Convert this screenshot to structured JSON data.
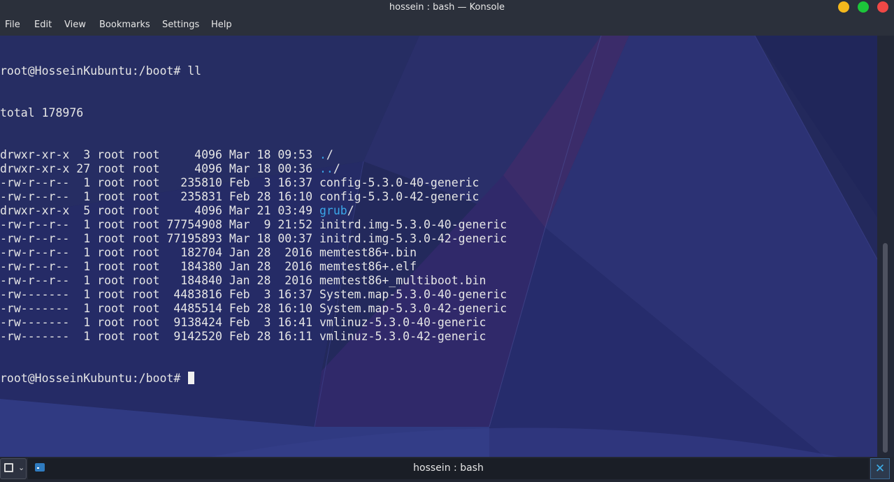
{
  "window": {
    "title": "hossein : bash — Konsole"
  },
  "menu": [
    "File",
    "Edit",
    "View",
    "Bookmarks",
    "Settings",
    "Help"
  ],
  "terminal": {
    "prompt": "root@HosseinKubuntu:/boot# ",
    "command": "ll",
    "total": "total 178976",
    "entries": [
      {
        "meta": "drwxr-xr-x  3 root root     4096 Mar 18 09:53 ",
        "name": ".",
        "suffix": "/",
        "is_dir": true
      },
      {
        "meta": "drwxr-xr-x 27 root root     4096 Mar 18 00:36 ",
        "name": "..",
        "suffix": "/",
        "is_dir": true
      },
      {
        "meta": "-rw-r--r--  1 root root   235810 Feb  3 16:37 ",
        "name": "config-5.3.0-40-generic",
        "suffix": "",
        "is_dir": false
      },
      {
        "meta": "-rw-r--r--  1 root root   235831 Feb 28 16:10 ",
        "name": "config-5.3.0-42-generic",
        "suffix": "",
        "is_dir": false
      },
      {
        "meta": "drwxr-xr-x  5 root root     4096 Mar 21 03:49 ",
        "name": "grub",
        "suffix": "/",
        "is_dir": true
      },
      {
        "meta": "-rw-r--r--  1 root root 77754908 Mar  9 21:52 ",
        "name": "initrd.img-5.3.0-40-generic",
        "suffix": "",
        "is_dir": false
      },
      {
        "meta": "-rw-r--r--  1 root root 77195893 Mar 18 00:37 ",
        "name": "initrd.img-5.3.0-42-generic",
        "suffix": "",
        "is_dir": false
      },
      {
        "meta": "-rw-r--r--  1 root root   182704 Jan 28  2016 ",
        "name": "memtest86+.bin",
        "suffix": "",
        "is_dir": false
      },
      {
        "meta": "-rw-r--r--  1 root root   184380 Jan 28  2016 ",
        "name": "memtest86+.elf",
        "suffix": "",
        "is_dir": false
      },
      {
        "meta": "-rw-r--r--  1 root root   184840 Jan 28  2016 ",
        "name": "memtest86+_multiboot.bin",
        "suffix": "",
        "is_dir": false
      },
      {
        "meta": "-rw-------  1 root root  4483816 Feb  3 16:37 ",
        "name": "System.map-5.3.0-40-generic",
        "suffix": "",
        "is_dir": false
      },
      {
        "meta": "-rw-------  1 root root  4485514 Feb 28 16:10 ",
        "name": "System.map-5.3.0-42-generic",
        "suffix": "",
        "is_dir": false
      },
      {
        "meta": "-rw-------  1 root root  9138424 Feb  3 16:41 ",
        "name": "vmlinuz-5.3.0-40-generic",
        "suffix": "",
        "is_dir": false
      },
      {
        "meta": "-rw-------  1 root root  9142520 Feb 28 16:11 ",
        "name": "vmlinuz-5.3.0-42-generic",
        "suffix": "",
        "is_dir": false
      }
    ],
    "final_prompt": "root@HosseinKubuntu:/boot# "
  },
  "tabs": [
    {
      "label": "hossein : bash"
    }
  ],
  "colors": {
    "directory": "#3aa6e8",
    "text": "#e6e6e6",
    "background": "#23295c",
    "accent": "#3daee9"
  },
  "icons": {
    "new_tab": "new-tab-icon",
    "close_tab": "close-icon",
    "terminal": "terminal-icon"
  }
}
